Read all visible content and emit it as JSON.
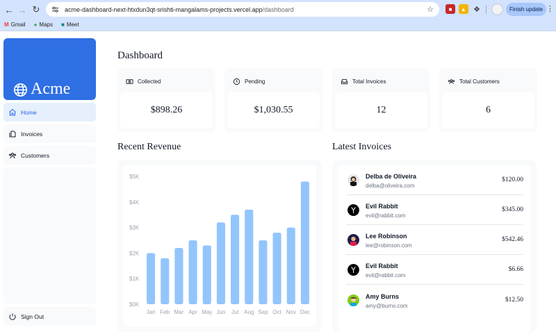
{
  "browser": {
    "url_host": "acme-dashboard-next-htxdun3qt-srishti-mangalams-projects.vercel.app",
    "url_path": "/dashboard",
    "finish_update_label": "Finish update",
    "bookmarks": [
      {
        "label": "Gmail",
        "icon": "gmail-icon"
      },
      {
        "label": "Maps",
        "icon": "maps-icon"
      },
      {
        "label": "Meet",
        "icon": "meet-icon"
      }
    ]
  },
  "sidebar": {
    "brand": "Acme",
    "items": [
      {
        "label": "Home",
        "icon": "home-icon",
        "active": true
      },
      {
        "label": "Invoices",
        "icon": "document-icon",
        "active": false
      },
      {
        "label": "Customers",
        "icon": "users-icon",
        "active": false
      }
    ],
    "sign_out_label": "Sign Out"
  },
  "page": {
    "title": "Dashboard"
  },
  "cards": [
    {
      "title": "Collected",
      "value": "$898.26",
      "icon": "banknotes-icon"
    },
    {
      "title": "Pending",
      "value": "$1,030.55",
      "icon": "clock-icon"
    },
    {
      "title": "Total Invoices",
      "value": "12",
      "icon": "inbox-icon"
    },
    {
      "title": "Total Customers",
      "value": "6",
      "icon": "user-group-icon"
    }
  ],
  "revenue": {
    "title": "Recent Revenue",
    "bar_color": "#93c5fd"
  },
  "chart_data": {
    "type": "bar",
    "title": "",
    "xlabel": "",
    "ylabel": "",
    "categories": [
      "Jan",
      "Feb",
      "Mar",
      "Apr",
      "May",
      "Jun",
      "Jul",
      "Aug",
      "Sep",
      "Oct",
      "Nov",
      "Dec"
    ],
    "values": [
      2000,
      1800,
      2200,
      2500,
      2300,
      3200,
      3500,
      3700,
      2500,
      2800,
      3000,
      4800
    ],
    "y_ticks": [
      "$0K",
      "$1K",
      "$2K",
      "$3K",
      "$4K",
      "$5K"
    ],
    "ylim": [
      0,
      5000
    ],
    "grid": false
  },
  "latest_invoices": {
    "title": "Latest Invoices",
    "rows": [
      {
        "name": "Delba de Oliveira",
        "email": "delba@oliveira.com",
        "amount": "$120.00",
        "avatar": "avatar-delba"
      },
      {
        "name": "Evil Rabbit",
        "email": "evil@rabbit.com",
        "amount": "$345.00",
        "avatar": "avatar-rabbit"
      },
      {
        "name": "Lee Robinson",
        "email": "lee@robinson.com",
        "amount": "$542.46",
        "avatar": "avatar-lee"
      },
      {
        "name": "Evil Rabbit",
        "email": "evil@rabbit.com",
        "amount": "$6.66",
        "avatar": "avatar-rabbit"
      },
      {
        "name": "Amy Burns",
        "email": "amy@burns.com",
        "amount": "$12.50",
        "avatar": "avatar-amy"
      }
    ]
  },
  "colors": {
    "accent": "#2f6fe4",
    "active_bg": "#e6f0fc",
    "active_text": "#2563eb",
    "panel_bg": "#f9fafb"
  }
}
